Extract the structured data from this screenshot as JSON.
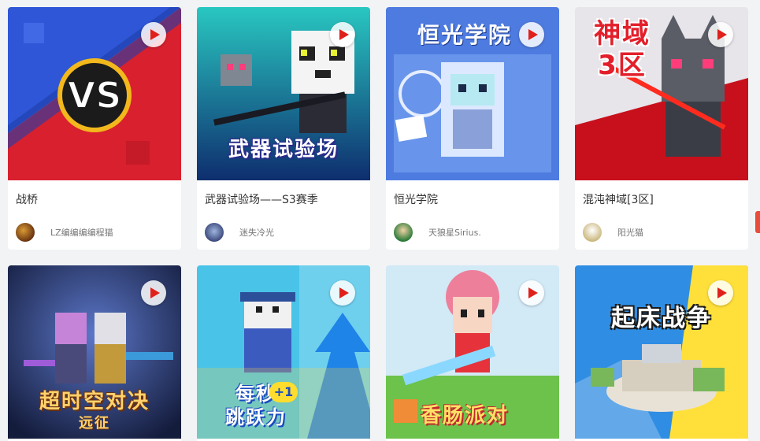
{
  "cards": [
    {
      "name": "战桥",
      "author": "LZ编编编编程猫",
      "thumb_text": "",
      "play_icon": "play-icon"
    },
    {
      "name": "武器试验场——S3赛季",
      "author": "迷失冷光",
      "thumb_text": "武器试验场",
      "play_icon": "play-icon"
    },
    {
      "name": "恒光学院",
      "author": "天狼星Sirius.",
      "thumb_text": "恒光学院",
      "play_icon": "play-icon"
    },
    {
      "name": "混沌神域[3区]",
      "author": "阳光猫",
      "thumb_text": "神域\n3区",
      "play_icon": "play-icon"
    },
    {
      "name": "",
      "author": "",
      "thumb_text": "超时空对决",
      "thumb_sub": "远征",
      "play_icon": "play-icon"
    },
    {
      "name": "",
      "author": "",
      "thumb_text": "每秒\n跳跃力",
      "thumb_badge": "+1",
      "play_icon": "play-icon"
    },
    {
      "name": "",
      "author": "",
      "thumb_text": "香肠派对",
      "play_icon": "play-icon"
    },
    {
      "name": "",
      "author": "",
      "thumb_text": "起床战争",
      "play_icon": "play-icon"
    }
  ],
  "colors": {
    "accent": "#e84c3d",
    "play": "#e0211b",
    "card_bg": "#ffffff",
    "page_bg": "#f2f3f5"
  }
}
